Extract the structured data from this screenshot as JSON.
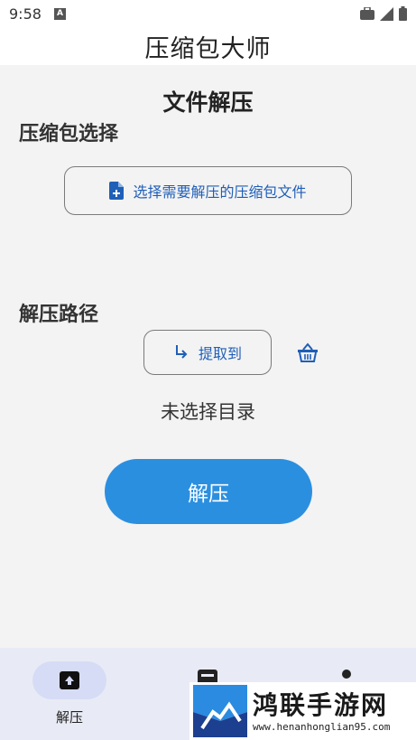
{
  "status_bar": {
    "time": "9:58",
    "badge": "A"
  },
  "app_bar": {
    "title": "压缩包大师"
  },
  "main": {
    "section_title": "文件解压",
    "archive_label": "压缩包选择",
    "select_button_label": "选择需要解压的压缩包文件",
    "path_label": "解压路径",
    "extract_to_label": "提取到",
    "no_directory_text": "未选择目录",
    "extract_button_label": "解压"
  },
  "bottom_nav": {
    "items": [
      {
        "label": "解压",
        "active": true
      }
    ]
  },
  "watermark": {
    "name": "鸿联手游网",
    "url": "www.henanhonglian95.com"
  },
  "colors": {
    "accent": "#2b8fe0",
    "link": "#1f5fb8",
    "nav_bg": "#e8ebf5"
  }
}
